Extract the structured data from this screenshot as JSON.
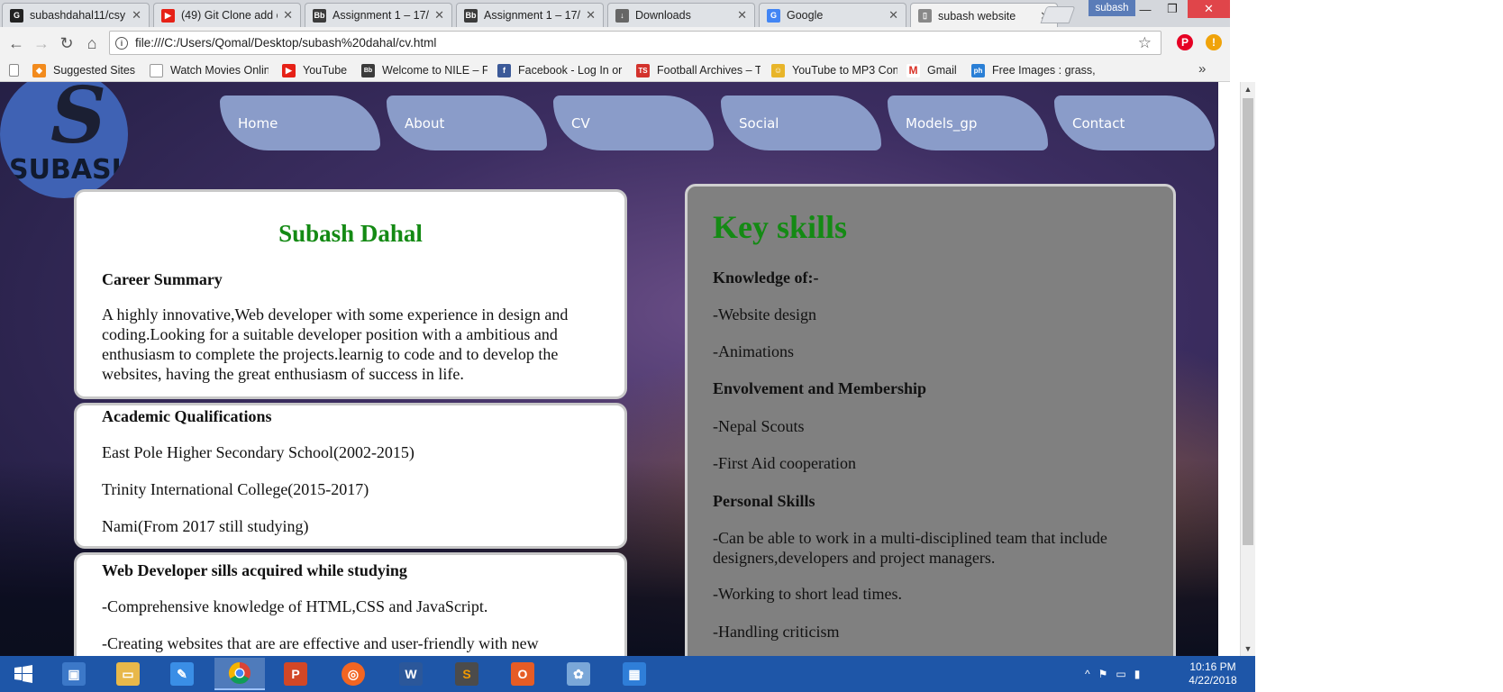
{
  "browser": {
    "tabs": [
      {
        "label": "subashdahal11/csy",
        "icon": "github-icon",
        "color": "#222222",
        "glyph": "G"
      },
      {
        "label": "(49) Git Clone add c",
        "icon": "youtube-icon",
        "color": "#e62117",
        "glyph": "▶"
      },
      {
        "label": "Assignment 1 – 17/",
        "icon": "blackboard-icon",
        "color": "#3b3b3b",
        "glyph": "Bb"
      },
      {
        "label": "Assignment 1 – 17/",
        "icon": "blackboard-icon",
        "color": "#3b3b3b",
        "glyph": "Bb"
      },
      {
        "label": "Downloads",
        "icon": "download-icon",
        "color": "#666666",
        "glyph": "↓"
      },
      {
        "label": "Google",
        "icon": "google-icon",
        "color": "#4285f4",
        "glyph": "G"
      },
      {
        "label": "subash website",
        "icon": "page-icon",
        "color": "#888888",
        "glyph": "▯"
      }
    ],
    "tab_close": "✕",
    "profile": "subash",
    "window_controls": {
      "minimize": "—",
      "restore": "❐",
      "close": "✕"
    },
    "address": "file:///C:/Users/Qomal/Desktop/subash%20dahal/cv.html",
    "nav_icons": {
      "back": "←",
      "forward": "→",
      "reload": "↻",
      "home": "⌂"
    },
    "bookmarks": [
      {
        "label": "Suggested Sites",
        "icon": "suggested-sites-icon",
        "color": "#f28b1e",
        "glyph": "◆"
      },
      {
        "label": "Watch Movies Online",
        "icon": "page-icon",
        "color": "#999999",
        "glyph": "▯"
      },
      {
        "label": "YouTube",
        "icon": "youtube-icon",
        "color": "#e62117",
        "glyph": "▶"
      },
      {
        "label": "Welcome to NILE – F",
        "icon": "blackboard-icon",
        "color": "#3b3b3b",
        "glyph": "Bb"
      },
      {
        "label": "Facebook - Log In or",
        "icon": "facebook-icon",
        "color": "#3b5998",
        "glyph": "f"
      },
      {
        "label": "Football Archives – T",
        "icon": "football-icon",
        "color": "#d3322c",
        "glyph": "TS"
      },
      {
        "label": "YouTube to MP3 Con",
        "icon": "converter-icon",
        "color": "#e8b52a",
        "glyph": "☺"
      },
      {
        "label": "Gmail",
        "icon": "gmail-icon",
        "color": "#d93025",
        "glyph": "M"
      },
      {
        "label": "Free Images : grass, l",
        "icon": "pixabay-icon",
        "color": "#2a7fd6",
        "glyph": "ph"
      }
    ],
    "bookmarks_more": "»"
  },
  "site": {
    "logo_letter": "S",
    "logo_word": "SUBASH",
    "nav": [
      "Home",
      "About",
      "CV",
      "Social",
      "Models_gp",
      "Contact"
    ],
    "summary": {
      "name": "Subash Dahal",
      "heading": "Career Summary",
      "text": "A highly innovative,Web developer with some experience in design and coding.Looking for a suitable developer position with a ambitious and enthusiasm to complete the projects.learnig to code and to develop the websites, having the great enthusiasm of success in life."
    },
    "academic": {
      "heading": "Academic Qualifications",
      "items": [
        "East Pole Higher Secondary School(2002-2015)",
        "Trinity International College(2015-2017)",
        "Nami(From 2017 still studying)"
      ]
    },
    "devskills": {
      "heading": "Web Developer sills acquired while studying",
      "items": [
        "-Comprehensive knowledge of HTML,CSS and JavaScript.",
        "-Creating websites that are are effective and user-friendly with new"
      ]
    },
    "skills": {
      "title": "Key skills",
      "knowledge_heading": "Knowledge of:-",
      "knowledge": [
        "-Website design",
        "-Animations"
      ],
      "involvement_heading": "Envolvement and Membership",
      "involvement": [
        "-Nepal Scouts",
        "-First Aid cooperation"
      ],
      "personal_heading": "Personal Skills",
      "personal": [
        "-Can be able to work in a multi-disciplined team that include designers,developers and project managers.",
        "-Working to short lead times.",
        "-Handling criticism"
      ]
    }
  },
  "taskbar": {
    "apps": [
      {
        "name": "start",
        "icon": "windows-start-icon",
        "color": "#1e56a8",
        "glyph": "⊞"
      },
      {
        "name": "task view",
        "icon": "task-view-icon",
        "color": "#3c78c8",
        "glyph": "▣"
      },
      {
        "name": "file explorer",
        "icon": "folder-icon",
        "color": "#e8b84a",
        "glyph": "▭"
      },
      {
        "name": "notepad",
        "icon": "notepad-icon",
        "color": "#3a8ee6",
        "glyph": "✎"
      },
      {
        "name": "chrome",
        "icon": "chrome-icon",
        "color": "#db4437",
        "glyph": "◉"
      },
      {
        "name": "powerpoint",
        "icon": "powerpoint-icon",
        "color": "#d24726",
        "glyph": "P"
      },
      {
        "name": "media",
        "icon": "media-icon",
        "color": "#f26522",
        "glyph": "◎"
      },
      {
        "name": "word",
        "icon": "word-icon",
        "color": "#2b579a",
        "glyph": "W"
      },
      {
        "name": "sublime text",
        "icon": "sublime-icon",
        "color": "#4b4b4b",
        "glyph": "S"
      },
      {
        "name": "office",
        "icon": "office-icon",
        "color": "#e65c25",
        "glyph": "O"
      },
      {
        "name": "paint",
        "icon": "paint-icon",
        "color": "#7aa7d8",
        "glyph": "✿"
      },
      {
        "name": "photos",
        "icon": "photos-icon",
        "color": "#2f7ed8",
        "glyph": "▦"
      }
    ],
    "tray_icons": [
      "^",
      "⚑",
      "▭",
      "▮"
    ],
    "time": "10:16 PM",
    "date": "4/22/2018"
  }
}
